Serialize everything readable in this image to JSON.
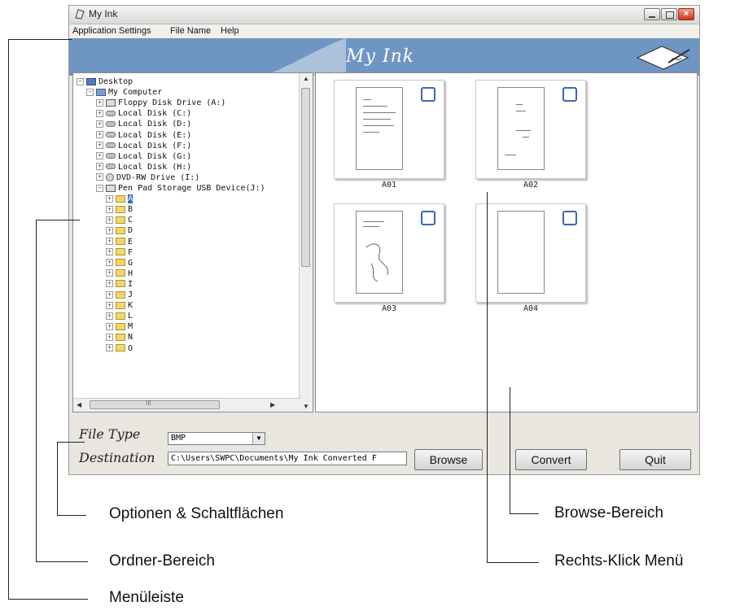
{
  "window": {
    "title": "My Ink",
    "banner_title": "My Ink"
  },
  "menu": [
    "Application Settings",
    "File Name",
    "Help"
  ],
  "tree": {
    "items": [
      {
        "label": "Desktop",
        "icon": "desktop-icon",
        "expander": "−"
      },
      {
        "label": "My Computer",
        "icon": "computer-icon",
        "expander": "−"
      },
      {
        "label": "Floppy Disk Drive (A:)",
        "icon": "floppy-icon",
        "expander": "+"
      },
      {
        "label": "Local Disk (C:)",
        "icon": "disk-icon",
        "expander": "+"
      },
      {
        "label": "Local Disk (D:)",
        "icon": "disk-icon",
        "expander": "+"
      },
      {
        "label": "Local Disk (E:)",
        "icon": "disk-icon",
        "expander": "+"
      },
      {
        "label": "Local Disk (F:)",
        "icon": "disk-icon",
        "expander": "+"
      },
      {
        "label": "Local Disk (G:)",
        "icon": "disk-icon",
        "expander": "+"
      },
      {
        "label": "Local Disk (H:)",
        "icon": "disk-icon",
        "expander": "+"
      },
      {
        "label": "DVD-RW Drive (I:)",
        "icon": "dvd-icon",
        "expander": "+"
      },
      {
        "label": "Pen Pad Storage USB Device(J:)",
        "icon": "usb-drive-icon",
        "expander": "−"
      },
      {
        "label": "A",
        "icon": "folder-icon",
        "expander": "+",
        "selected": true
      },
      {
        "label": "B",
        "icon": "folder-icon",
        "expander": "+"
      },
      {
        "label": "C",
        "icon": "folder-icon",
        "expander": "+"
      },
      {
        "label": "D",
        "icon": "folder-icon",
        "expander": "+"
      },
      {
        "label": "E",
        "icon": "folder-icon",
        "expander": "+"
      },
      {
        "label": "F",
        "icon": "folder-icon",
        "expander": "+"
      },
      {
        "label": "G",
        "icon": "folder-icon",
        "expander": "+"
      },
      {
        "label": "H",
        "icon": "folder-icon",
        "expander": "+"
      },
      {
        "label": "I",
        "icon": "folder-icon",
        "expander": "+"
      },
      {
        "label": "J",
        "icon": "folder-icon",
        "expander": "+"
      },
      {
        "label": "K",
        "icon": "folder-icon",
        "expander": "+"
      },
      {
        "label": "L",
        "icon": "folder-icon",
        "expander": "+"
      },
      {
        "label": "M",
        "icon": "folder-icon",
        "expander": "+"
      },
      {
        "label": "N",
        "icon": "folder-icon",
        "expander": "+"
      },
      {
        "label": "O",
        "icon": "folder-icon",
        "expander": "+"
      }
    ],
    "hscroll_glyph": "III"
  },
  "thumbnails": [
    {
      "label": "A01"
    },
    {
      "label": "A02"
    },
    {
      "label": "A03"
    },
    {
      "label": "A04"
    }
  ],
  "options": {
    "file_type_label": "File Type",
    "file_type_value": "BMP",
    "destination_label": "Destination",
    "destination_value": "C:\\Users\\SWPC\\Documents\\My Ink Converted F",
    "browse_button": "Browse",
    "convert_button": "Convert",
    "quit_button": "Quit"
  },
  "callouts": {
    "options": "Optionen & Schaltflächen",
    "browse_area": "Browse-Bereich",
    "folder_area": "Ordner-Bereich",
    "context_menu": "Rechts-Klick Menü",
    "menu_bar": "Menüleiste"
  },
  "colors": {
    "banner": "#6f95c3",
    "selection": "#316ac5",
    "checkbox": "#3a66b4"
  }
}
